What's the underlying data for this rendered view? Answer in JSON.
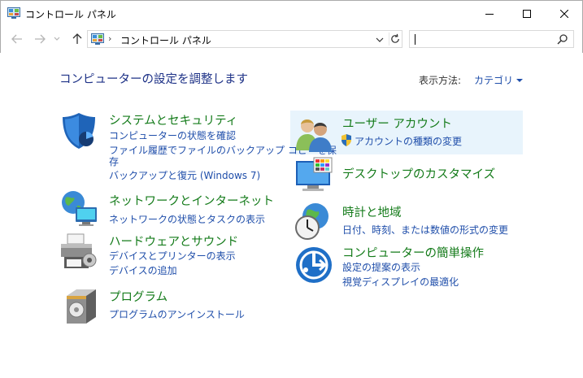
{
  "window": {
    "title": "コントロール パネル",
    "minimize": "minimize",
    "maximize": "maximize",
    "close": "close"
  },
  "addressbar": {
    "separator": "›",
    "path": "コントロール パネル",
    "search_value": ""
  },
  "header": {
    "title": "コンピューターの設定を調整します",
    "view_by_label": "表示方法:",
    "view_by_value": "カテゴリ"
  },
  "categories": {
    "system": {
      "title": "システムとセキュリティ",
      "links": [
        "コンピューターの状態を確認",
        "ファイル履歴でファイルのバックアップ コピーを保",
        "存",
        "バックアップと復元 (Windows 7)"
      ]
    },
    "network": {
      "title": "ネットワークとインターネット",
      "links": [
        "ネットワークの状態とタスクの表示"
      ]
    },
    "hardware": {
      "title": "ハードウェアとサウンド",
      "links": [
        "デバイスとプリンターの表示",
        "デバイスの追加"
      ]
    },
    "programs": {
      "title": "プログラム",
      "links": [
        "プログラムのアンインストール"
      ]
    },
    "accounts": {
      "title": "ユーザー アカウント",
      "links": [
        "アカウントの種類の変更"
      ]
    },
    "appearance": {
      "title": "デスクトップのカスタマイズ",
      "links": []
    },
    "clock": {
      "title": "時計と地域",
      "links": [
        "日付、時刻、または数値の形式の変更"
      ]
    },
    "ease": {
      "title": "コンピューターの簡単操作",
      "links": [
        "設定の提案の表示",
        "視覚ディスプレイの最適化"
      ]
    }
  },
  "colors": {
    "category_title": "#147b1a",
    "link": "#1f4eaa",
    "page_title": "#1e3287",
    "hover_bg": "#e8f4fc"
  }
}
